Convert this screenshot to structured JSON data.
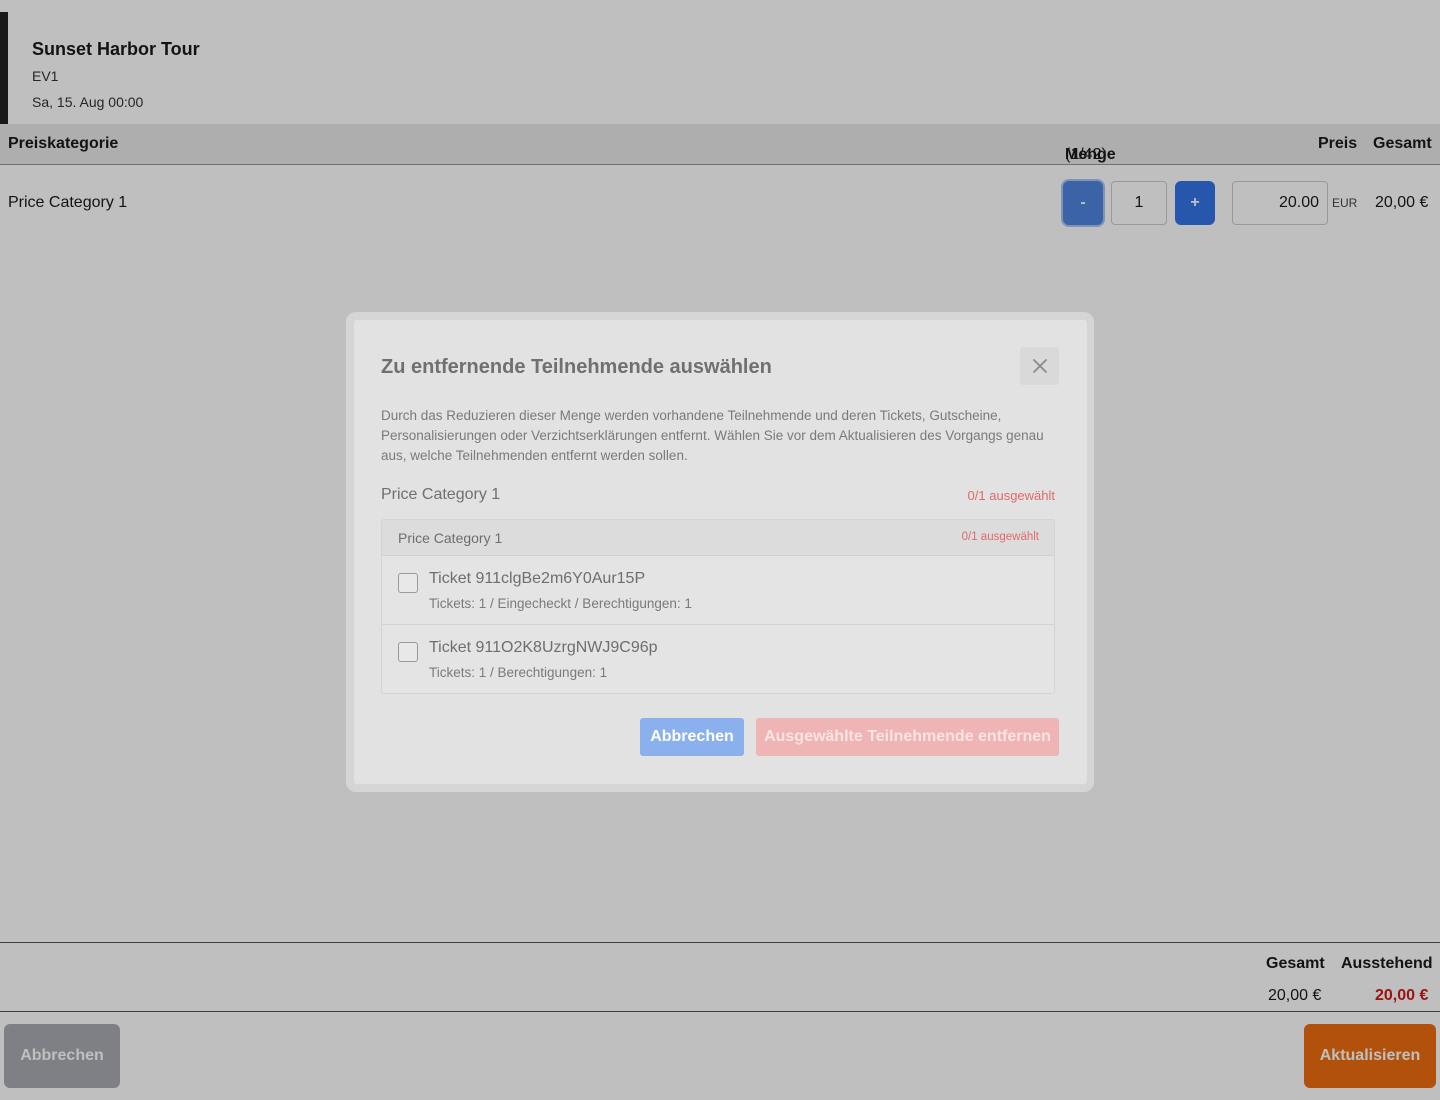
{
  "event": {
    "title": "Sunset Harbor Tour",
    "code": "EV1",
    "date": "Sa, 15. Aug 00:00"
  },
  "table": {
    "headers": {
      "category": "Preiskategorie",
      "quantity": "Menge",
      "quantity_count": "(1/42)",
      "price": "Preis",
      "total": "Gesamt"
    },
    "rows": [
      {
        "category": "Price Category 1",
        "minus_label": "-",
        "quantity": "1",
        "plus_label": "+",
        "price": "20.00",
        "currency": "EUR",
        "total": "20,00 €"
      }
    ]
  },
  "summary": {
    "total_label": "Gesamt",
    "outstanding_label": "Ausstehend",
    "total_value": "20,00 €",
    "outstanding_value": "20,00 €"
  },
  "footer": {
    "cancel_label": "Abbrechen",
    "update_label": "Aktualisieren"
  },
  "modal": {
    "title": "Zu entfernende Teilnehmende auswählen",
    "description": "Durch das Reduzieren dieser Menge werden vorhandene Teilnehmende und deren Tickets, Gutscheine, Personalisierungen oder Verzichtserklärungen entfernt. Wählen Sie vor dem Aktualisieren des Vorgangs genau aus, welche Teilnehmenden entfernt werden sollen.",
    "section_label": "Price Category 1",
    "section_count": "0/1 ausgewählt",
    "list": {
      "header_label": "Price Category 1",
      "header_count": "0/1 ausgewählt",
      "tickets": [
        {
          "name": "Ticket 911clgBe2m6Y0Aur15P",
          "meta": "Tickets: 1 / Eingecheckt / Berechtigungen: 1",
          "checked": false
        },
        {
          "name": "Ticket 911O2K8UzrgNWJ9C96p",
          "meta": "Tickets: 1 / Berechtigungen: 1",
          "checked": false
        }
      ]
    },
    "cancel_label": "Abbrechen",
    "remove_label": "Ausgewählte Teilnehmende entfernen"
  },
  "colors": {
    "accent_blue": "#3575e6",
    "accent_orange": "#ec6c10",
    "outstanding_red": "#d11a1a"
  }
}
